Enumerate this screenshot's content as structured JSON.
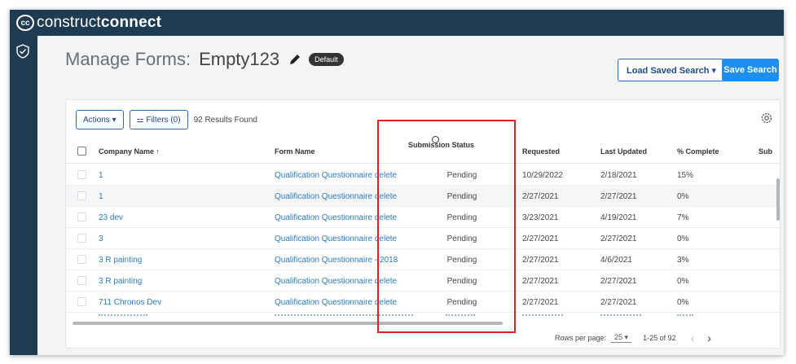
{
  "app": {
    "brand_prefix": "construct",
    "brand_suffix": "connect"
  },
  "page": {
    "title_prefix": "Manage Forms:",
    "title_name": "Empty123",
    "badge": "Default",
    "load_saved_search": "Load Saved Search ▾",
    "save_search": "Save Search"
  },
  "toolbar": {
    "actions": "Actions ▾",
    "filters": "⚍ Filters (0)",
    "results": "92 Results Found"
  },
  "table": {
    "headers": {
      "company": "Company Name ↑",
      "form": "Form Name",
      "status": "Submission Status",
      "requested": "Requested",
      "updated": "Last Updated",
      "complete": "% Complete",
      "sub": "Sub"
    },
    "rows": [
      {
        "company": "1",
        "form": "Qualification Questionnaire delete",
        "status": "Pending",
        "requested": "10/29/2022",
        "updated": "2/18/2021",
        "complete": "15%"
      },
      {
        "company": "1",
        "form": "Qualification Questionnaire delete",
        "status": "Pending",
        "requested": "2/27/2021",
        "updated": "2/27/2021",
        "complete": "0%"
      },
      {
        "company": "23 dev",
        "form": "Qualification Questionnaire delete",
        "status": "Pending",
        "requested": "3/23/2021",
        "updated": "4/19/2021",
        "complete": "7%"
      },
      {
        "company": "3",
        "form": "Qualification Questionnaire delete",
        "status": "Pending",
        "requested": "2/27/2021",
        "updated": "2/27/2021",
        "complete": "0%"
      },
      {
        "company": "3 R painting",
        "form": "Qualification Questionnaire - 2018",
        "status": "Pending",
        "requested": "2/27/2021",
        "updated": "4/6/2021",
        "complete": "3%"
      },
      {
        "company": "3 R painting",
        "form": "Qualification Questionnaire delete",
        "status": "Pending",
        "requested": "2/27/2021",
        "updated": "2/27/2021",
        "complete": "0%"
      },
      {
        "company": "711 Chronos Dev",
        "form": "Qualification Questionnaire delete",
        "status": "Pending",
        "requested": "2/27/2021",
        "updated": "2/27/2021",
        "complete": "0%"
      }
    ]
  },
  "pagination": {
    "rows_per_page_label": "Rows per page:",
    "rows_per_page_value": "25 ▾",
    "range": "1-25 of 92",
    "prev": "‹",
    "next": "›"
  },
  "colors": {
    "nav": "#1f3b52",
    "accent": "#1d8ff0",
    "link": "#2a7bc8",
    "highlight": "#e02020"
  }
}
